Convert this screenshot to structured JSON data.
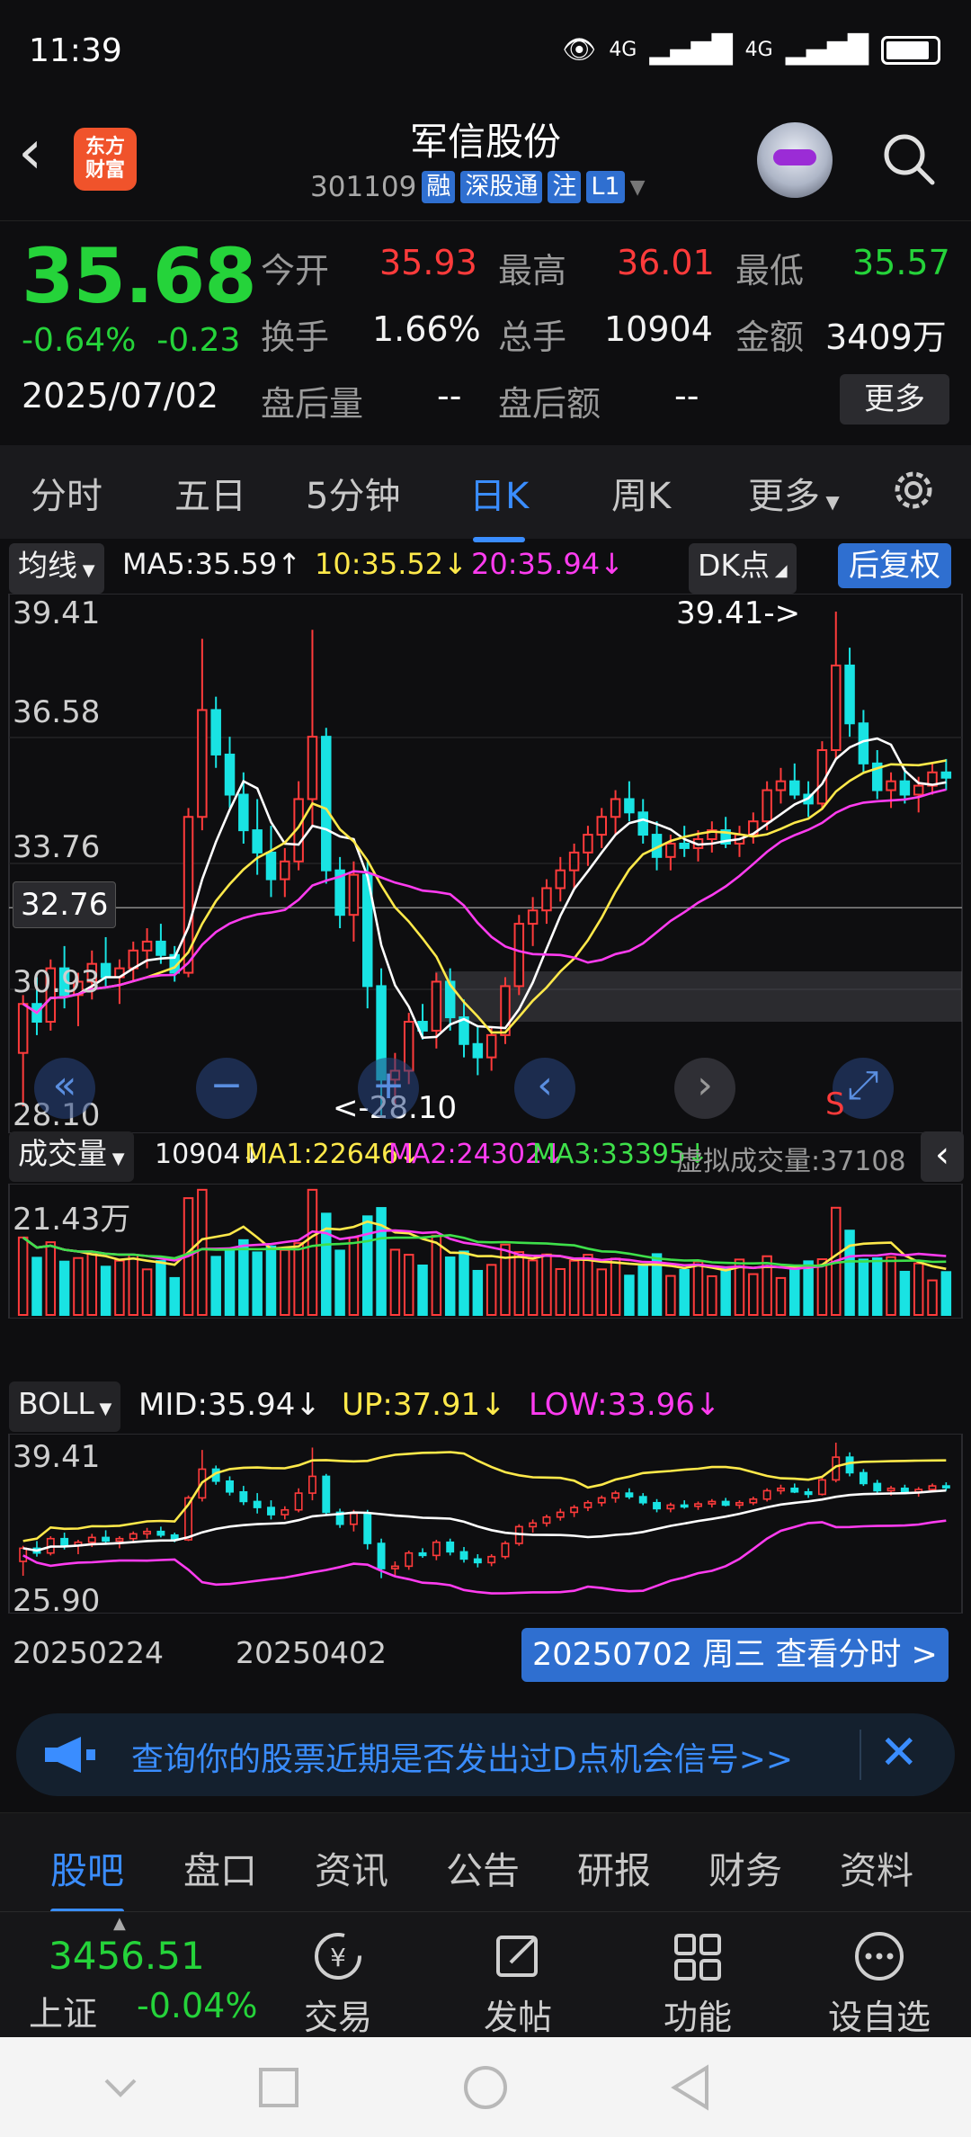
{
  "status": {
    "time": "11:39",
    "net1": "4G",
    "net2": "4G"
  },
  "header": {
    "title": "军信股份",
    "code": "301109",
    "tags": [
      "融",
      "深股通",
      "注",
      "L1"
    ],
    "logo_line1": "东方",
    "logo_line2": "财富"
  },
  "quote": {
    "price": "35.68",
    "change_pct": "-0.64%",
    "change_amt": "-0.23",
    "date": "2025/07/02",
    "open_label": "今开",
    "open": "35.93",
    "high_label": "最高",
    "high": "36.01",
    "low_label": "最低",
    "low": "35.57",
    "turnover_label": "换手",
    "turnover": "1.66%",
    "volume_label": "总手",
    "volume": "10904",
    "amount_label": "金额",
    "amount": "3409万",
    "after_vol_label": "盘后量",
    "after_vol": "--",
    "after_amt_label": "盘后额",
    "after_amt": "--",
    "more": "更多"
  },
  "period_tabs": [
    "分时",
    "五日",
    "5分钟",
    "日K",
    "周K",
    "更多"
  ],
  "period_active": "日K",
  "kline": {
    "ma_label": "均线",
    "ma5": "MA5:35.59↑",
    "ma10": "10:35.52↓",
    "ma20": "20:35.94↓",
    "dk_label": "DK点",
    "fq_label": "后复权",
    "y_labels": [
      "39.41",
      "36.58",
      "33.76",
      "30.93",
      "28.10"
    ],
    "crosshair_price": "32.76",
    "max_mark": "39.41->",
    "min_mark": "<-28.10",
    "s_mark": "S"
  },
  "volume": {
    "label": "成交量",
    "val": "10904↓",
    "ma1": "MA1:22646↓",
    "ma2": "MA2:24302↓",
    "ma3": "MA3:33395↓",
    "virtual": "虚拟成交量:37108",
    "y_label": "21.43万"
  },
  "boll": {
    "label": "BOLL",
    "mid": "MID:35.94↓",
    "up": "UP:37.91↓",
    "low": "LOW:33.96↓",
    "y_top": "39.41",
    "y_bottom": "25.90"
  },
  "xaxis": {
    "d1": "20250224",
    "d2": "20250402",
    "btn": "20250702 周三 查看分时 >"
  },
  "notice": {
    "text": "查询你的股票近期是否发出过D点机会信号>>"
  },
  "bottom_tabs": [
    "股吧",
    "盘口",
    "资讯",
    "公告",
    "研报",
    "财务",
    "资料"
  ],
  "bottom_active": "股吧",
  "index": {
    "value": "3456.51",
    "name": "上证",
    "change": "-0.04%"
  },
  "actions": [
    "交易",
    "发帖",
    "功能",
    "设自选"
  ],
  "chart_data": {
    "type": "candlestick",
    "price_ylim": [
      28.1,
      39.41
    ],
    "candles": [
      [
        29.5,
        30.8,
        28.3,
        30.6
      ],
      [
        30.6,
        31.2,
        29.9,
        30.2
      ],
      [
        30.2,
        31.6,
        30.0,
        31.4
      ],
      [
        31.4,
        31.9,
        30.5,
        30.8
      ],
      [
        30.8,
        31.3,
        30.1,
        31.1
      ],
      [
        31.1,
        31.8,
        30.7,
        31.5
      ],
      [
        31.5,
        32.1,
        31.0,
        31.2
      ],
      [
        31.2,
        31.6,
        30.6,
        31.4
      ],
      [
        31.4,
        32.0,
        31.1,
        31.8
      ],
      [
        31.8,
        32.3,
        31.4,
        32.0
      ],
      [
        32.0,
        32.4,
        31.5,
        31.7
      ],
      [
        31.7,
        31.9,
        31.1,
        31.3
      ],
      [
        31.3,
        35.0,
        31.2,
        34.8
      ],
      [
        34.8,
        38.8,
        34.5,
        37.2
      ],
      [
        37.2,
        37.5,
        35.9,
        36.2
      ],
      [
        36.2,
        36.6,
        35.0,
        35.3
      ],
      [
        35.3,
        35.8,
        34.2,
        34.5
      ],
      [
        34.5,
        35.2,
        33.5,
        34.0
      ],
      [
        34.0,
        34.6,
        33.0,
        33.4
      ],
      [
        33.4,
        34.1,
        33.0,
        33.8
      ],
      [
        33.8,
        35.6,
        33.6,
        35.2
      ],
      [
        35.2,
        39.0,
        34.6,
        36.6
      ],
      [
        36.6,
        36.8,
        33.3,
        33.6
      ],
      [
        33.6,
        33.9,
        32.3,
        32.6
      ],
      [
        32.6,
        33.8,
        32.0,
        33.5
      ],
      [
        33.5,
        33.8,
        30.5,
        31.0
      ],
      [
        31.0,
        31.4,
        28.1,
        28.9
      ],
      [
        28.9,
        29.5,
        28.3,
        29.1
      ],
      [
        29.1,
        30.4,
        28.8,
        30.2
      ],
      [
        30.2,
        30.6,
        29.8,
        30.0
      ],
      [
        30.0,
        31.3,
        29.6,
        31.1
      ],
      [
        31.1,
        31.4,
        30.0,
        30.3
      ],
      [
        30.3,
        30.7,
        29.4,
        29.7
      ],
      [
        29.7,
        30.1,
        29.0,
        29.4
      ],
      [
        29.4,
        30.1,
        29.1,
        29.9
      ],
      [
        29.9,
        31.2,
        29.7,
        31.0
      ],
      [
        31.0,
        32.6,
        30.8,
        32.4
      ],
      [
        32.4,
        33.0,
        31.9,
        32.7
      ],
      [
        32.7,
        33.4,
        32.4,
        33.2
      ],
      [
        33.2,
        33.9,
        32.9,
        33.6
      ],
      [
        33.6,
        34.2,
        33.2,
        34.0
      ],
      [
        34.0,
        34.6,
        33.7,
        34.4
      ],
      [
        34.4,
        35.0,
        34.1,
        34.8
      ],
      [
        34.8,
        35.4,
        34.4,
        35.2
      ],
      [
        35.2,
        35.6,
        34.7,
        34.9
      ],
      [
        34.9,
        35.2,
        34.2,
        34.4
      ],
      [
        34.4,
        34.7,
        33.6,
        33.9
      ],
      [
        33.9,
        34.4,
        33.6,
        34.2
      ],
      [
        34.2,
        34.6,
        33.9,
        34.1
      ],
      [
        34.1,
        34.5,
        33.8,
        34.3
      ],
      [
        34.3,
        34.7,
        34.0,
        34.5
      ],
      [
        34.5,
        34.8,
        34.1,
        34.2
      ],
      [
        34.2,
        34.6,
        33.9,
        34.4
      ],
      [
        34.4,
        34.9,
        34.2,
        34.7
      ],
      [
        34.7,
        35.6,
        34.5,
        35.4
      ],
      [
        35.4,
        35.9,
        35.1,
        35.6
      ],
      [
        35.6,
        36.0,
        35.2,
        35.3
      ],
      [
        35.3,
        35.6,
        34.8,
        35.1
      ],
      [
        35.1,
        36.5,
        35.0,
        36.3
      ],
      [
        36.3,
        39.41,
        36.1,
        38.2
      ],
      [
        38.2,
        38.6,
        36.6,
        36.9
      ],
      [
        36.9,
        37.2,
        35.8,
        36.0
      ],
      [
        36.0,
        36.3,
        35.2,
        35.4
      ],
      [
        35.4,
        35.8,
        35.0,
        35.6
      ],
      [
        35.6,
        35.9,
        35.1,
        35.3
      ],
      [
        35.3,
        35.7,
        34.9,
        35.5
      ],
      [
        35.5,
        36.0,
        35.3,
        35.8
      ],
      [
        35.8,
        36.1,
        35.4,
        35.68
      ]
    ],
    "indicators": {
      "MA5": "35.59",
      "MA10": "35.52",
      "MA20": "35.94",
      "VOL": "10904",
      "VOL_MA1": "22646",
      "VOL_MA2": "24302",
      "VOL_MA3": "33395",
      "BOLL_MID": "35.94",
      "BOLL_UP": "37.91",
      "BOLL_LOW": "33.96"
    },
    "volume_ylim": [
      0,
      214300
    ],
    "boll_ylim": [
      25.9,
      39.41
    ],
    "xaxis_ticks": [
      "20250224",
      "20250402"
    ]
  }
}
